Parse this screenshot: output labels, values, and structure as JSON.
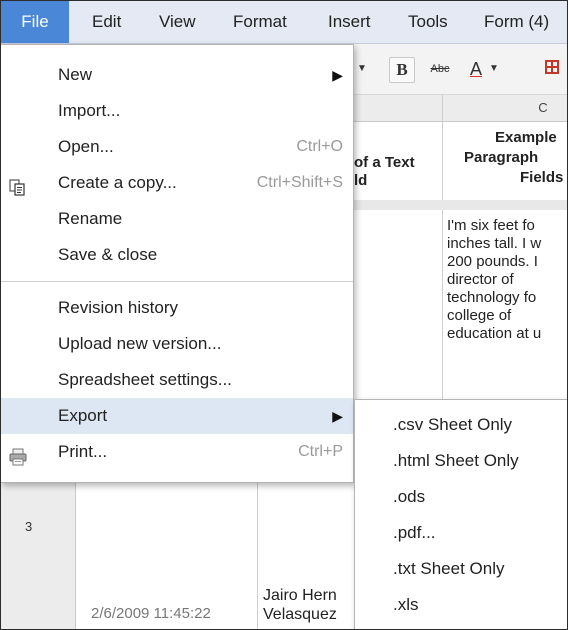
{
  "menubar": {
    "items": [
      {
        "label": "File"
      },
      {
        "label": "Edit"
      },
      {
        "label": "View"
      },
      {
        "label": "Format"
      },
      {
        "label": "Insert"
      },
      {
        "label": "Tools"
      },
      {
        "label": "Form (4)"
      }
    ]
  },
  "toolbar": {
    "bold_label": "B",
    "strike_label": "Abc",
    "text_color_label": "A"
  },
  "sheet": {
    "column_c_label": "C",
    "row_3_label": "3",
    "header_b_line1": "of a Text",
    "header_b_line2": "ld",
    "header_c_line1": "Example",
    "header_c_line2": "Paragraph",
    "header_c_line3": "Fields",
    "para_lines": [
      "I'm six feet fo",
      "inches tall. I w",
      "200 pounds. I",
      "director of",
      "technology fo",
      "college of",
      "education at u"
    ],
    "timestamp": "2/6/2009 11:45:22",
    "name_line1": "Jairo Hern",
    "name_line2": "Velasquez"
  },
  "file_menu": {
    "new": "New",
    "import": "Import...",
    "open": "Open...",
    "open_shortcut": "Ctrl+O",
    "create_copy": "Create a copy...",
    "create_copy_shortcut": "Ctrl+Shift+S",
    "rename": "Rename",
    "save_close": "Save & close",
    "revision_history": "Revision history",
    "upload_new_version": "Upload new version...",
    "spreadsheet_settings": "Spreadsheet settings...",
    "export": "Export",
    "print": "Print...",
    "print_shortcut": "Ctrl+P",
    "submenu_arrow": "▶"
  },
  "export_menu": {
    "items": [
      {
        "label": ".csv Sheet Only"
      },
      {
        "label": ".html Sheet Only"
      },
      {
        "label": ".ods"
      },
      {
        "label": ".pdf..."
      },
      {
        "label": ".txt Sheet Only"
      },
      {
        "label": ".xls"
      }
    ]
  },
  "colors": {
    "menubar_bg": "#e4e9f3",
    "active_menu_bg": "#4a87d6",
    "highlight_bg": "#dde6f3"
  },
  "icons": {
    "copy": "copy-icon",
    "print": "printer-icon",
    "submenu": "triangle-right-icon"
  }
}
